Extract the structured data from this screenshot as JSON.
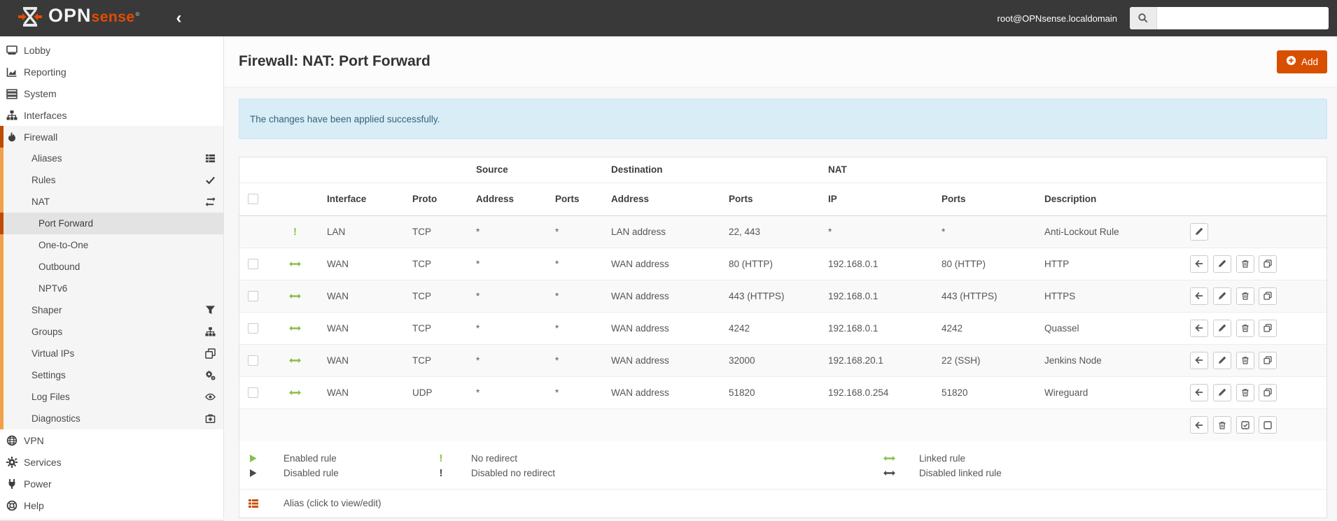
{
  "navbar": {
    "brand_opn": "OPN",
    "brand_sense": "sense",
    "brand_reg": "®",
    "collapse_icon": "‹",
    "user": "root@OPNsense.localdomain",
    "search_value": ""
  },
  "sidebar": {
    "items": [
      {
        "label": "Lobby"
      },
      {
        "label": "Reporting"
      },
      {
        "label": "System"
      },
      {
        "label": "Interfaces"
      },
      {
        "label": "Firewall"
      },
      {
        "label": "Aliases"
      },
      {
        "label": "Rules"
      },
      {
        "label": "NAT"
      },
      {
        "label": "Port Forward"
      },
      {
        "label": "One-to-One"
      },
      {
        "label": "Outbound"
      },
      {
        "label": "NPTv6"
      },
      {
        "label": "Shaper"
      },
      {
        "label": "Groups"
      },
      {
        "label": "Virtual IPs"
      },
      {
        "label": "Settings"
      },
      {
        "label": "Log Files"
      },
      {
        "label": "Diagnostics"
      },
      {
        "label": "VPN"
      },
      {
        "label": "Services"
      },
      {
        "label": "Power"
      },
      {
        "label": "Help"
      }
    ]
  },
  "page": {
    "title": "Firewall: NAT: Port Forward",
    "add_label": "Add",
    "alert": "The changes have been applied successfully."
  },
  "table": {
    "group_headers": {
      "source": "Source",
      "destination": "Destination",
      "nat": "NAT"
    },
    "headers": {
      "interface": "Interface",
      "proto": "Proto",
      "src_address": "Address",
      "src_ports": "Ports",
      "dst_address": "Address",
      "dst_ports": "Ports",
      "nat_ip": "IP",
      "nat_ports": "Ports",
      "description": "Description"
    },
    "rows": [
      {
        "interface": "LAN",
        "proto": "TCP",
        "src_address": "*",
        "src_ports": "*",
        "dst_address": "LAN address",
        "dst_ports": "22, 443",
        "nat_ip": "*",
        "nat_ports": "*",
        "description": "Anti-Lockout Rule"
      },
      {
        "interface": "WAN",
        "proto": "TCP",
        "src_address": "*",
        "src_ports": "*",
        "dst_address": "WAN address",
        "dst_ports": "80 (HTTP)",
        "nat_ip": "192.168.0.1",
        "nat_ports": "80 (HTTP)",
        "description": "HTTP"
      },
      {
        "interface": "WAN",
        "proto": "TCP",
        "src_address": "*",
        "src_ports": "*",
        "dst_address": "WAN address",
        "dst_ports": "443 (HTTPS)",
        "nat_ip": "192.168.0.1",
        "nat_ports": "443 (HTTPS)",
        "description": "HTTPS"
      },
      {
        "interface": "WAN",
        "proto": "TCP",
        "src_address": "*",
        "src_ports": "*",
        "dst_address": "WAN address",
        "dst_ports": "4242",
        "nat_ip": "192.168.0.1",
        "nat_ports": "4242",
        "description": "Quassel"
      },
      {
        "interface": "WAN",
        "proto": "TCP",
        "src_address": "*",
        "src_ports": "*",
        "dst_address": "WAN address",
        "dst_ports": "32000",
        "nat_ip": "192.168.20.1",
        "nat_ports": "22 (SSH)",
        "description": "Jenkins Node"
      },
      {
        "interface": "WAN",
        "proto": "UDP",
        "src_address": "*",
        "src_ports": "*",
        "dst_address": "WAN address",
        "dst_ports": "51820",
        "nat_ip": "192.168.0.254",
        "nat_ports": "51820",
        "description": "Wireguard"
      }
    ]
  },
  "legend": {
    "enabled_rule": "Enabled rule",
    "disabled_rule": "Disabled rule",
    "no_redirect": "No redirect",
    "disabled_no_redirect": "Disabled no redirect",
    "linked_rule": "Linked rule",
    "disabled_linked_rule": "Disabled linked rule",
    "alias_note": "Alias (click to view/edit)"
  },
  "icons": {
    "no_redirect_glyph": "!"
  },
  "colors": {
    "accent_orange": "#d94f00",
    "logo_orange": "#e44c00",
    "enabled_green": "#8ac04a",
    "alert_bg": "#d9edf7",
    "navbar_bg": "#3a3939"
  }
}
